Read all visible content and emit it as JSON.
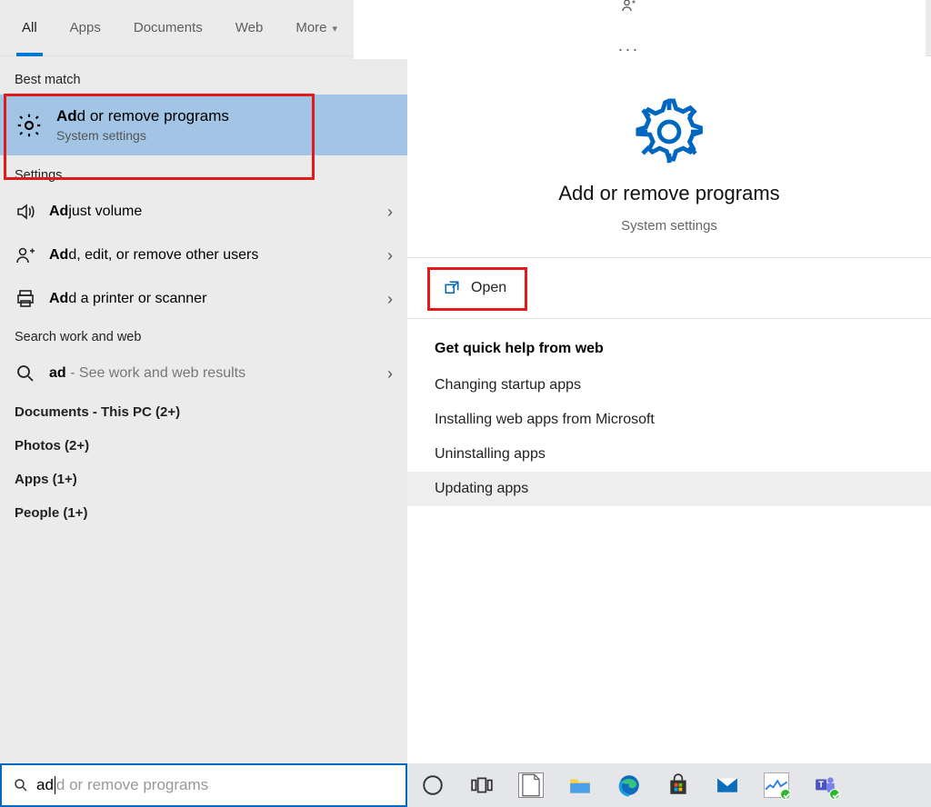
{
  "tabs": {
    "all": "All",
    "apps": "Apps",
    "documents": "Documents",
    "web": "Web",
    "more": "More"
  },
  "sections": {
    "best_match": "Best match",
    "settings": "Settings",
    "search_work_web": "Search work and web"
  },
  "best": {
    "title_bold": "Ad",
    "title_rest": "d or remove programs",
    "subtitle": "System settings"
  },
  "settings_items": [
    {
      "bold": "Ad",
      "rest": "just volume"
    },
    {
      "bold": "Ad",
      "rest": "d, edit, or remove other users"
    },
    {
      "bold": "Ad",
      "rest": "d a printer or scanner"
    }
  ],
  "web_item": {
    "bold": "ad",
    "grey": " - See work and web results"
  },
  "scopes": {
    "documents": "Documents - This PC (2+)",
    "photos": "Photos (2+)",
    "apps": "Apps (1+)",
    "people": "People (1+)"
  },
  "preview": {
    "title": "Add or remove programs",
    "subtitle": "System settings",
    "open": "Open",
    "help_title": "Get quick help from web",
    "help_items": [
      "Changing startup apps",
      "Installing web apps from Microsoft",
      "Uninstalling apps",
      "Updating apps"
    ]
  },
  "search": {
    "typed": "ad",
    "ghost": "d or remove programs"
  },
  "colors": {
    "accent": "#0067c0",
    "highlight_bg": "#a2c5e6",
    "annotation": "#e21a1a"
  }
}
